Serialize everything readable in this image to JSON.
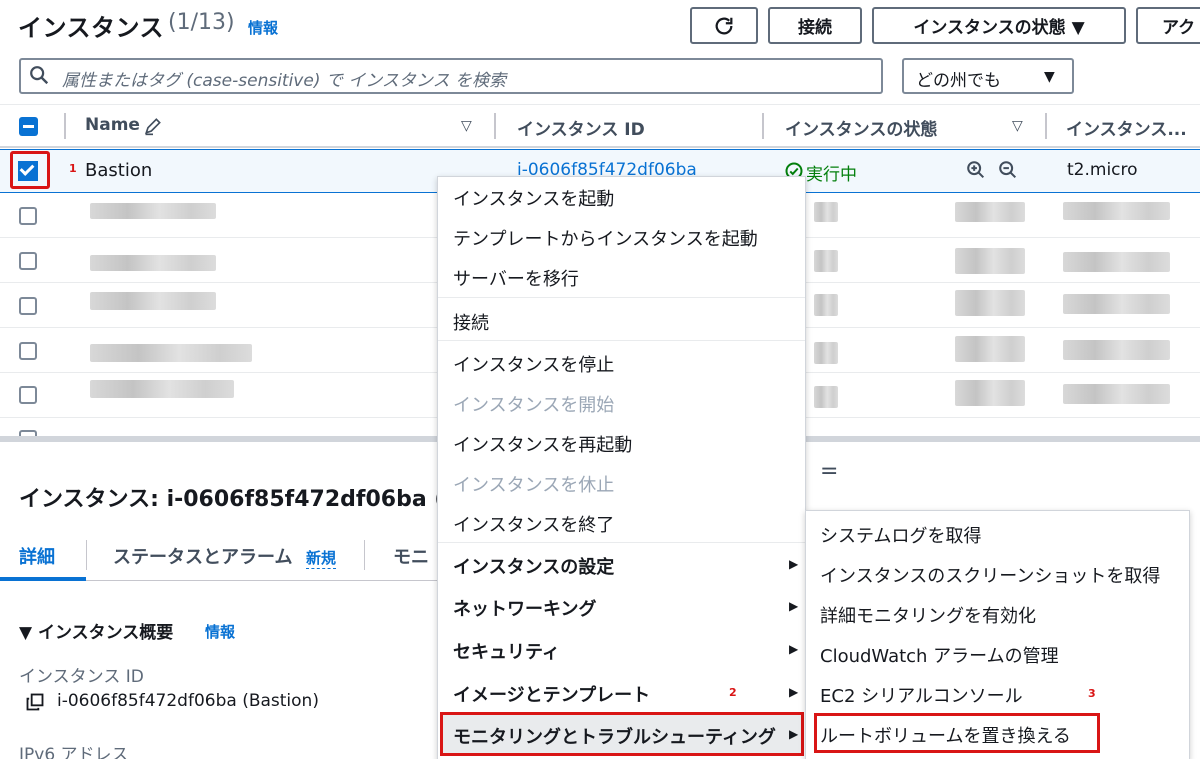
{
  "header": {
    "title": "インスタンス",
    "count": "(1/13)",
    "info": "情報",
    "connect_label": "接続",
    "state_label": "インスタンスの状態 ▼",
    "actions_label": "アク"
  },
  "search": {
    "placeholder": "属性またはタグ (case-sensitive) で インスタンス を検索",
    "region_value": "どの州でも"
  },
  "table": {
    "columns": [
      "Name",
      "インスタンス ID",
      "インスタンスの状態",
      "インスタンス..."
    ],
    "selected_row": {
      "name": "Bastion",
      "instance_id": "i-0606f85f472df06ba",
      "state": "実行中",
      "type": "t2.micro"
    }
  },
  "context_menu": {
    "items": [
      "インスタンスを起動",
      "テンプレートからインスタンスを起動",
      "サーバーを移行",
      "接続",
      "インスタンスを停止",
      "インスタンスを開始",
      "インスタンスを再起動",
      "インスタンスを休止",
      "インスタンスを終了",
      "インスタンスの設定",
      "ネットワーキング",
      "セキュリティ",
      "イメージとテンプレート",
      "モニタリングとトラブルシューティング"
    ]
  },
  "submenu": {
    "items": [
      "システムログを取得",
      "インスタンスのスクリーンショットを取得",
      "詳細モニタリングを有効化",
      "CloudWatch アラームの管理",
      "EC2 シリアルコンソール",
      "ルートボリュームを置き換える"
    ]
  },
  "details": {
    "title": "インスタンス: i-0606f85f472df06ba (",
    "tabs": [
      "詳細",
      "ステータスとアラーム",
      "モニ"
    ],
    "tab_new": "新規",
    "summary_title": "▼ インスタンス概要",
    "summary_info": "情報",
    "instance_id_label": "インスタンス ID",
    "instance_id_value": "i-0606f85f472df06ba (Bastion)",
    "ipv6_label": "IPv6 アドレス"
  },
  "annotations": {
    "step1": "1",
    "step2": "2",
    "step3": "3"
  },
  "colors": {
    "accent": "#0972d3",
    "highlight": "#d91515",
    "running": "#037f0c"
  }
}
